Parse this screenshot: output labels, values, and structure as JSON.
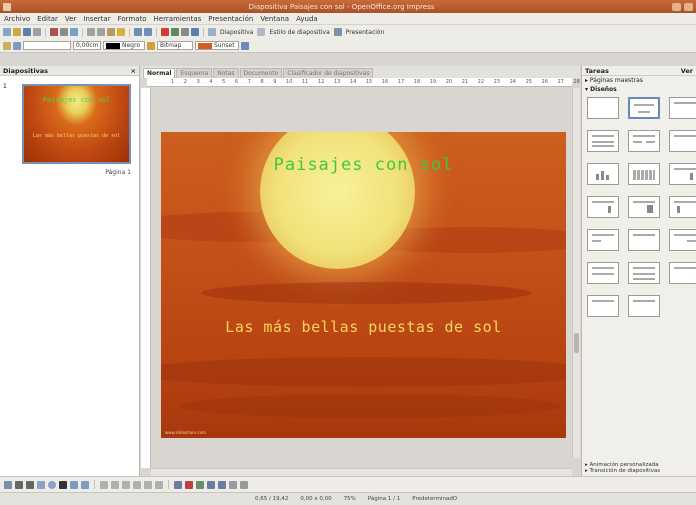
{
  "window": {
    "title": "Diapositiva Paisajes con sol - OpenOffice.org Impress"
  },
  "menu": [
    "Archivo",
    "Editar",
    "Ver",
    "Insertar",
    "Formato",
    "Herramientas",
    "Presentación",
    "Ventana",
    "Ayuda"
  ],
  "toolbar2": {
    "line_width": "0,00cm",
    "color_name": "Negro",
    "area_style": "Bitmap",
    "area_fill": "Sunset"
  },
  "toolbar1": {
    "slide_button": "Diapositiva",
    "design_button": "Estilo de diapositiva",
    "presentation_button": "Presentación"
  },
  "slides_pane": {
    "title": "Diapositivas",
    "thumb_number": "1",
    "thumb_label": "Página 1"
  },
  "editor_tabs": [
    "Normal",
    "Esquema",
    "Notas",
    "Documento",
    "Clasificador de diapositivas"
  ],
  "ruler_ticks": [
    "1",
    "2",
    "3",
    "4",
    "5",
    "6",
    "7",
    "8",
    "9",
    "10",
    "11",
    "12",
    "13",
    "14",
    "15",
    "16",
    "17",
    "18",
    "19",
    "20",
    "21",
    "22",
    "23",
    "24",
    "25",
    "26",
    "27",
    "28"
  ],
  "slide": {
    "title": "Paisajes con sol",
    "subtitle": "Las más bellas puestas de sol",
    "credit": "www.slideshare.com"
  },
  "tasks": {
    "title": "Tareas",
    "view": "Ver",
    "sections": [
      "Páginas maestras",
      "Diseños"
    ],
    "footer": [
      "Animación personalizada",
      "Transición de diapositivas"
    ]
  },
  "status": {
    "position": "0,65 / 19,42",
    "size": "0,00 x 0,00",
    "zoom": "75%",
    "page": "Página 1 / 1",
    "layout": "PredeterminadO"
  },
  "colors": {
    "title_green": "#3fc83f",
    "subtitle_yellow": "#f6d55c",
    "titlebar": "#b85a2e"
  }
}
